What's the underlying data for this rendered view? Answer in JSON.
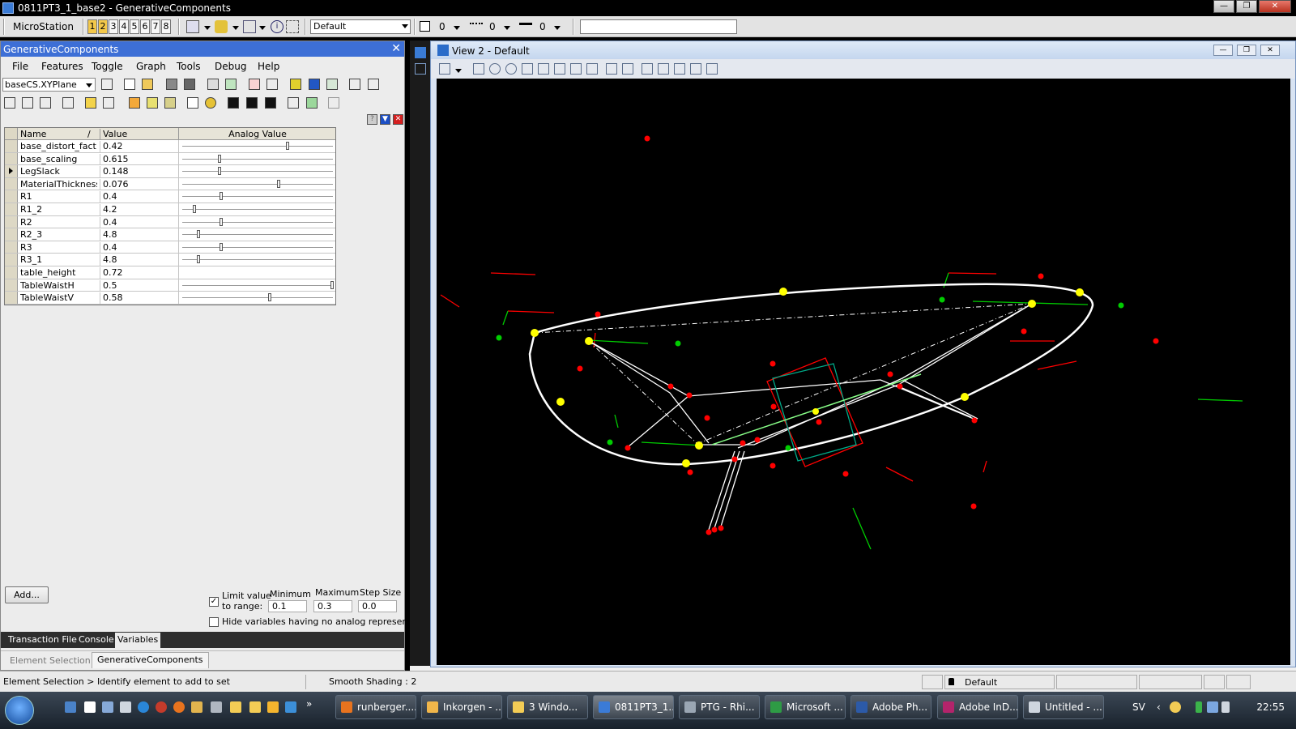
{
  "window": {
    "title": "0811PT3_1_base2 - GenerativeComponents"
  },
  "toolbar": {
    "app_name": "MicroStation",
    "view_numbers": [
      "1",
      "2",
      "3",
      "4",
      "5",
      "6",
      "7",
      "8"
    ],
    "level_combo": "Default",
    "color_value": "0",
    "style_value": "0",
    "weight_value": "0",
    "key_in": ""
  },
  "gc_panel": {
    "title": "GenerativeComponents",
    "menu": [
      "File",
      "Features",
      "Toggle",
      "Graph",
      "Tools",
      "Debug",
      "Help"
    ],
    "cs_select": "baseCS.XYPlane",
    "grid": {
      "headers": {
        "name": "Name",
        "sort": "/",
        "value": "Value",
        "analog": "Analog Value"
      },
      "rows": [
        {
          "name": "base_distort_fact...",
          "value": "0.42",
          "slider": 0.7
        },
        {
          "name": "base_scaling",
          "value": "0.615",
          "slider": 0.24
        },
        {
          "name": "LegSlack",
          "value": "0.148",
          "slider": 0.24,
          "current": true
        },
        {
          "name": "MaterialThickness",
          "value": "0.076",
          "slider": 0.64
        },
        {
          "name": "R1",
          "value": "0.4",
          "slider": 0.25
        },
        {
          "name": "R1_2",
          "value": "4.2",
          "slider": 0.07
        },
        {
          "name": "R2",
          "value": "0.4",
          "slider": 0.25
        },
        {
          "name": "R2_3",
          "value": "4.8",
          "slider": 0.1
        },
        {
          "name": "R3",
          "value": "0.4",
          "slider": 0.25
        },
        {
          "name": "R3_1",
          "value": "4.8",
          "slider": 0.1
        },
        {
          "name": "table_height",
          "value": "0.72",
          "slider": null
        },
        {
          "name": "TableWaistH",
          "value": "0.5",
          "slider": 1.0
        },
        {
          "name": "TableWaistV",
          "value": "0.58",
          "slider": 0.58
        }
      ]
    },
    "add_button": "Add...",
    "limit_label_1": "Limit value",
    "limit_label_2": "to range:",
    "limit_checked": true,
    "minimum_label": "Minimum",
    "maximum_label": "Maximum",
    "step_label": "Step Size",
    "minimum": "0.1",
    "maximum": "0.3",
    "step": "0.0",
    "hide_label": "Hide variables having no analog representatio",
    "tabs": [
      "Transaction File",
      "Console",
      "Variables"
    ],
    "bottom_tabs": [
      "Element Selection",
      "GenerativeComponents"
    ]
  },
  "view": {
    "title": "View 2 - Default"
  },
  "statusbar": {
    "prompt": "Element Selection > Identify element to add to set",
    "message": "Smooth Shading : 2",
    "level": "Default"
  },
  "taskbar": {
    "buttons": [
      {
        "label": "runberger....",
        "color": "#e8731e"
      },
      {
        "label": "Inkorgen - ...",
        "color": "#f1b64a"
      },
      {
        "label": "3 Windo...",
        "color": "#f3cc55"
      },
      {
        "label": "0811PT3_1...",
        "color": "#3b7bd6",
        "active": true
      },
      {
        "label": "PTG - Rhi...",
        "color": "#9aa6b3"
      },
      {
        "label": "Microsoft ...",
        "color": "#2e9b45"
      },
      {
        "label": "Adobe Ph...",
        "color": "#2c5aa8"
      },
      {
        "label": "Adobe InD...",
        "color": "#b3246b"
      },
      {
        "label": "Untitled - ...",
        "color": "#cfd6df"
      }
    ],
    "lang": "SV",
    "clock": "22:55"
  },
  "colors": {
    "gc_title": "#3d6fd6",
    "curve": "#ffffff",
    "point_yellow": "#ffff00",
    "point_red": "#ff0000",
    "point_green": "#00cc00",
    "axis_cyan": "#00ccaa"
  }
}
